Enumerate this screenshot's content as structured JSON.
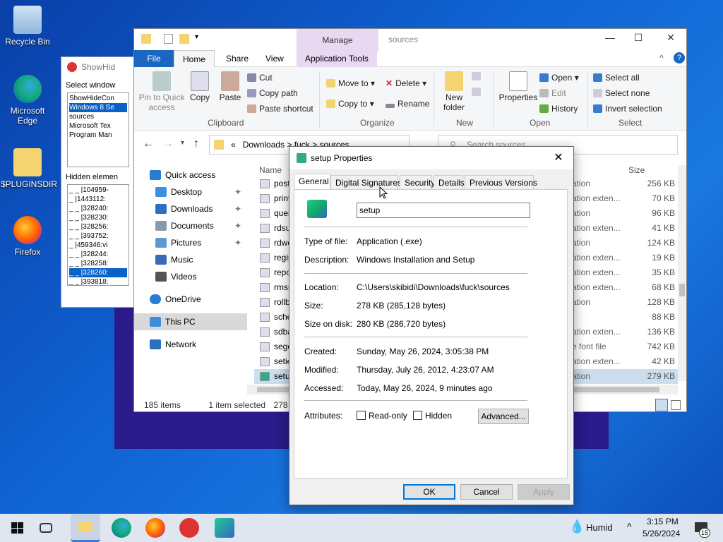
{
  "desktop": {
    "icons": [
      {
        "label": "Recycle Bin",
        "icon": "recycle-bin-icon"
      },
      {
        "label": "Microsoft Edge",
        "icon": "edge-icon"
      },
      {
        "label": "$PLUGINSDIR",
        "icon": "folder-icon"
      },
      {
        "label": "Firefox",
        "icon": "firefox-icon"
      }
    ]
  },
  "showhide": {
    "title": "ShowHid",
    "select_label": "Select window",
    "windows": [
      "ShowHideCon",
      "Windows 8 Se",
      "sources",
      "Microsoft Tex",
      "Program Man"
    ],
    "hidden_label": "Hidden elemen",
    "hidden": [
      "_ _ |104959-",
      "_ |1443112:",
      "_ _ |328240:",
      "_ _ |328230:",
      "_ _ |328256:",
      "_ _ |393752:",
      "_ |459346:vi",
      "_ _ |328244:",
      "_ _ |328258:",
      "_ _ |328260:",
      "_ _ |393818:"
    ]
  },
  "explorer": {
    "title": "sources",
    "manage": "Manage",
    "tabs": {
      "file": "File",
      "home": "Home",
      "share": "Share",
      "view": "View",
      "apptools": "Application Tools"
    },
    "ribbon": {
      "pin": "Pin to Quick access",
      "copy": "Copy",
      "paste": "Paste",
      "cut": "Cut",
      "copy_path": "Copy path",
      "paste_shortcut": "Paste shortcut",
      "clipboard": "Clipboard",
      "move_to": "Move to",
      "copy_to": "Copy to",
      "delete": "Delete",
      "rename": "Rename",
      "organize": "Organize",
      "new_folder": "New folder",
      "new": "New",
      "properties": "Properties",
      "open": "Open",
      "edit": "Edit",
      "history": "History",
      "open_group": "Open",
      "select_all": "Select all",
      "select_none": "Select none",
      "invert": "Invert selection",
      "select_group": "Select"
    },
    "address": {
      "p1": "Downloads",
      "p2": "fuck",
      "p3": "sources",
      "prefix": "«"
    },
    "search_placeholder": "Search sources",
    "nav": [
      {
        "label": "Quick access",
        "color": "#2a7bd6"
      },
      {
        "label": "Desktop",
        "color": "#3a8fe0"
      },
      {
        "label": "Downloads",
        "color": "#2a6fc0"
      },
      {
        "label": "Documents",
        "color": "#8899aa"
      },
      {
        "label": "Pictures",
        "color": "#5a9ad0"
      },
      {
        "label": "Music",
        "color": "#3a6ab8"
      },
      {
        "label": "Videos",
        "color": "#555"
      },
      {
        "label": "OneDrive",
        "color": "#2a7bd6"
      },
      {
        "label": "This PC",
        "color": "#3a8fe0"
      },
      {
        "label": "Network",
        "color": "#2a6fc0"
      }
    ],
    "col_name": "Name",
    "col_size": "Size",
    "files": [
      "post",
      "print",
      "quer",
      "rdsu",
      "rdwe",
      "regis",
      "repo",
      "rmsu",
      "rollb",
      "sche",
      "sdba",
      "segc",
      "setie",
      "setu"
    ],
    "right": [
      {
        "type": "ation",
        "size": "256 KB"
      },
      {
        "type": "ation exten...",
        "size": "70 KB"
      },
      {
        "type": "ation",
        "size": "96 KB"
      },
      {
        "type": "ation exten...",
        "size": "41 KB"
      },
      {
        "type": "ation",
        "size": "124 KB"
      },
      {
        "type": "ation exten...",
        "size": "19 KB"
      },
      {
        "type": "ation exten...",
        "size": "35 KB"
      },
      {
        "type": "ation exten...",
        "size": "68 KB"
      },
      {
        "type": "ation",
        "size": "128 KB"
      },
      {
        "type": "",
        "size": "88 KB"
      },
      {
        "type": "ation exten...",
        "size": "136 KB"
      },
      {
        "type": "e font file",
        "size": "742 KB"
      },
      {
        "type": "ation exten...",
        "size": "42 KB"
      },
      {
        "type": "ation",
        "size": "279 KB"
      }
    ],
    "status": {
      "items": "185 items",
      "selected": "1 item selected",
      "size": "278 KB"
    }
  },
  "props": {
    "title": "setup Properties",
    "tabs": [
      "General",
      "Digital Signatures",
      "Security",
      "Details",
      "Previous Versions"
    ],
    "name": "setup",
    "type_label": "Type of file:",
    "type": "Application (.exe)",
    "desc_label": "Description:",
    "desc": "Windows Installation and Setup",
    "loc_label": "Location:",
    "loc": "C:\\Users\\skibidi\\Downloads\\fuck\\sources",
    "size_label": "Size:",
    "size": "278 KB (285,128 bytes)",
    "disk_label": "Size on disk:",
    "disk": "280 KB (286,720 bytes)",
    "created_label": "Created:",
    "created": "Sunday, May 26, 2024, 3:05:38 PM",
    "modified_label": "Modified:",
    "modified": "Thursday, July 26, 2012, 4:23:07 AM",
    "accessed_label": "Accessed:",
    "accessed": "Today, May 26, 2024, 9 minutes ago",
    "attr_label": "Attributes:",
    "readonly": "Read-only",
    "hidden": "Hidden",
    "advanced": "Advanced...",
    "ok": "OK",
    "cancel": "Cancel",
    "apply": "Apply"
  },
  "taskbar": {
    "weather": "Humid",
    "time": "3:15 PM",
    "date": "5/26/2024",
    "notif": "15"
  }
}
